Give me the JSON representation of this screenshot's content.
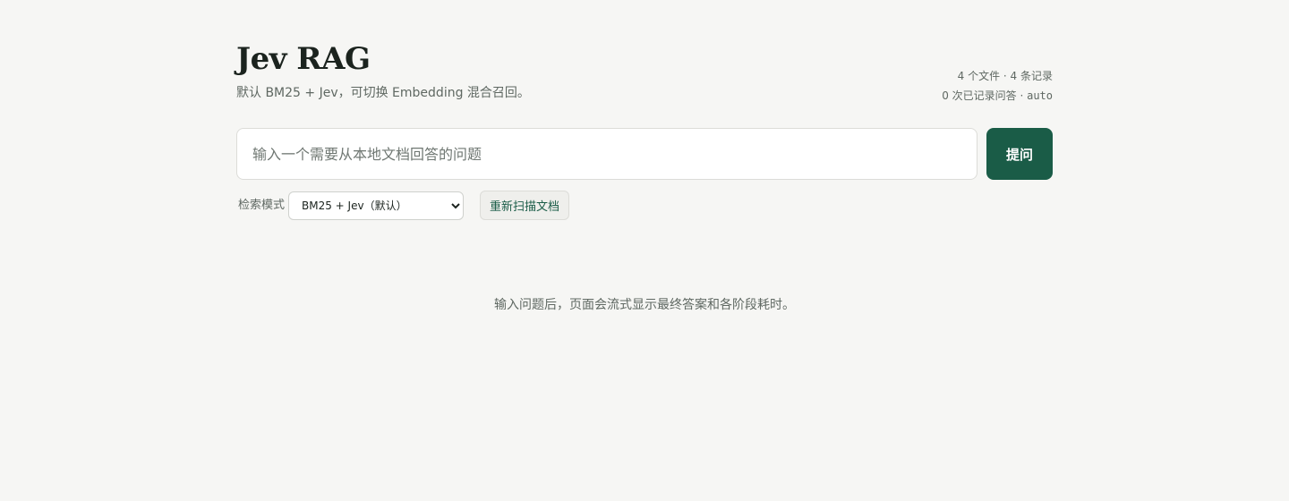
{
  "header": {
    "title": "Jev RAG",
    "subtitle": "默认 BM25 + Jev，可切换 Embedding 混合召回。"
  },
  "stats": {
    "files": "4 个文件 · 4 条记录",
    "answers_prefix": "0 次已记录问答 · ",
    "mode": "auto"
  },
  "ask": {
    "placeholder": "输入一个需要从本地文档回答的问题",
    "value": "",
    "button_label": "提问"
  },
  "controls": {
    "mode_label": "检索模式",
    "mode_selected": "BM25 + Jev（默认）",
    "rescan_label": "重新扫描文档"
  },
  "main": {
    "hint": "输入问题后，页面会流式显示最终答案和各阶段耗时。"
  }
}
